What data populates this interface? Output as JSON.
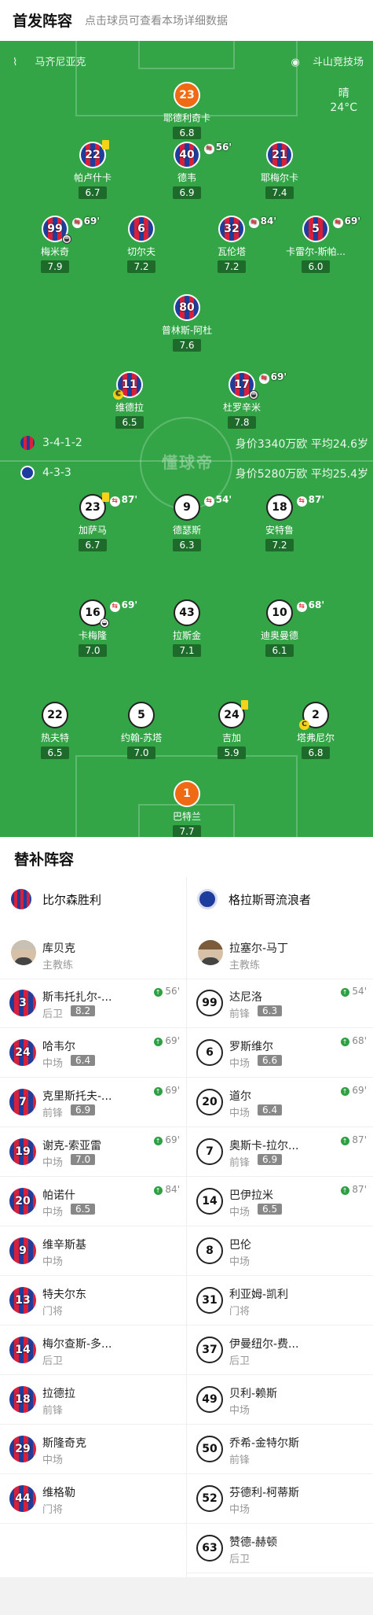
{
  "header": {
    "title": "首发阵容",
    "hint": "点击球员可查看本场详细数据"
  },
  "venue": {
    "country": "马齐尼亚克",
    "stadium": "斗山竞技场"
  },
  "weather": {
    "condition": "晴",
    "temp": "24°C"
  },
  "watermark": "懂球帝",
  "home": {
    "formation": "3-4-1-2",
    "value": "身价3340万欧 平均24.6岁",
    "players": [
      {
        "no": "23",
        "name": "耶德利奇卡",
        "rating": "6.8"
      },
      {
        "no": "22",
        "name": "帕卢什卡",
        "rating": "6.7"
      },
      {
        "no": "40",
        "name": "德韦",
        "rating": "6.9",
        "sub": "56'"
      },
      {
        "no": "21",
        "name": "耶梅尔卡",
        "rating": "7.4"
      },
      {
        "no": "99",
        "name": "梅米奇",
        "rating": "7.9",
        "sub": "69'"
      },
      {
        "no": "6",
        "name": "切尔夫",
        "rating": "7.2"
      },
      {
        "no": "32",
        "name": "瓦伦塔",
        "rating": "7.2",
        "sub": "84'"
      },
      {
        "no": "5",
        "name": "卡雷尔-斯帕...",
        "rating": "6.0",
        "sub": "69'"
      },
      {
        "no": "80",
        "name": "普林斯-阿杜",
        "rating": "7.6"
      },
      {
        "no": "11",
        "name": "维德拉",
        "rating": "6.5"
      },
      {
        "no": "17",
        "name": "杜罗辛米",
        "rating": "7.8",
        "sub": "69'"
      }
    ]
  },
  "away": {
    "formation": "4-3-3",
    "value": "身价5280万欧 平均25.4岁",
    "players": [
      {
        "no": "23",
        "name": "加萨马",
        "rating": "6.7",
        "sub": "87'"
      },
      {
        "no": "9",
        "name": "德瑟斯",
        "rating": "6.3",
        "sub": "54'"
      },
      {
        "no": "18",
        "name": "安特鲁",
        "rating": "7.2",
        "sub": "87'"
      },
      {
        "no": "16",
        "name": "卡梅隆",
        "rating": "7.0",
        "sub": "69'"
      },
      {
        "no": "43",
        "name": "拉斯金",
        "rating": "7.1"
      },
      {
        "no": "10",
        "name": "迪奥曼德",
        "rating": "6.1",
        "sub": "68'"
      },
      {
        "no": "22",
        "name": "热夫特",
        "rating": "6.5"
      },
      {
        "no": "5",
        "name": "约翰-苏塔",
        "rating": "7.0"
      },
      {
        "no": "24",
        "name": "吉加",
        "rating": "5.9"
      },
      {
        "no": "2",
        "name": "塔弗尼尔",
        "rating": "6.8"
      },
      {
        "no": "1",
        "name": "巴特兰",
        "rating": "7.7"
      }
    ]
  },
  "subs": {
    "title": "替补阵容",
    "home_team": "比尔森胜利",
    "away_team": "格拉斯哥流浪者",
    "home_coach": {
      "name": "库贝克",
      "role": "主教练"
    },
    "away_coach": {
      "name": "拉塞尔-马丁",
      "role": "主教练"
    },
    "home_list": [
      {
        "no": "3",
        "name": "斯韦托扎尔-...",
        "pos": "后卫",
        "rating": "8.2",
        "min": "56'"
      },
      {
        "no": "24",
        "name": "哈韦尔",
        "pos": "中场",
        "rating": "6.4",
        "min": "69'"
      },
      {
        "no": "7",
        "name": "克里斯托夫-...",
        "pos": "前锋",
        "rating": "6.9",
        "min": "69'"
      },
      {
        "no": "19",
        "name": "谢克-索亚雷",
        "pos": "中场",
        "rating": "7.0",
        "min": "69'"
      },
      {
        "no": "20",
        "name": "帕诺什",
        "pos": "中场",
        "rating": "6.5",
        "min": "84'"
      },
      {
        "no": "9",
        "name": "维辛斯基",
        "pos": "中场"
      },
      {
        "no": "13",
        "name": "特夫尔东",
        "pos": "门将"
      },
      {
        "no": "14",
        "name": "梅尔查斯-多...",
        "pos": "后卫"
      },
      {
        "no": "18",
        "name": "拉德拉",
        "pos": "前锋"
      },
      {
        "no": "29",
        "name": "斯隆奇克",
        "pos": "中场"
      },
      {
        "no": "44",
        "name": "维格勒",
        "pos": "门将"
      }
    ],
    "away_list": [
      {
        "no": "99",
        "name": "达尼洛",
        "pos": "前锋",
        "rating": "6.3",
        "min": "54'"
      },
      {
        "no": "6",
        "name": "罗斯维尔",
        "pos": "中场",
        "rating": "6.6",
        "min": "68'"
      },
      {
        "no": "20",
        "name": "道尔",
        "pos": "中场",
        "rating": "6.4",
        "min": "69'"
      },
      {
        "no": "7",
        "name": "奥斯卡-拉尔...",
        "pos": "前锋",
        "rating": "6.9",
        "min": "87'"
      },
      {
        "no": "14",
        "name": "巴伊拉米",
        "pos": "中场",
        "rating": "6.5",
        "min": "87'"
      },
      {
        "no": "8",
        "name": "巴伦",
        "pos": "中场"
      },
      {
        "no": "31",
        "name": "利亚姆-凯利",
        "pos": "门将"
      },
      {
        "no": "37",
        "name": "伊曼纽尔-费...",
        "pos": "后卫"
      },
      {
        "no": "49",
        "name": "贝利-赖斯",
        "pos": "中场"
      },
      {
        "no": "50",
        "name": "乔希-金特尔斯",
        "pos": "前锋"
      },
      {
        "no": "52",
        "name": "芬德利-柯蒂斯",
        "pos": "中场"
      },
      {
        "no": "63",
        "name": "赞德-赫顿",
        "pos": "后卫"
      }
    ]
  }
}
